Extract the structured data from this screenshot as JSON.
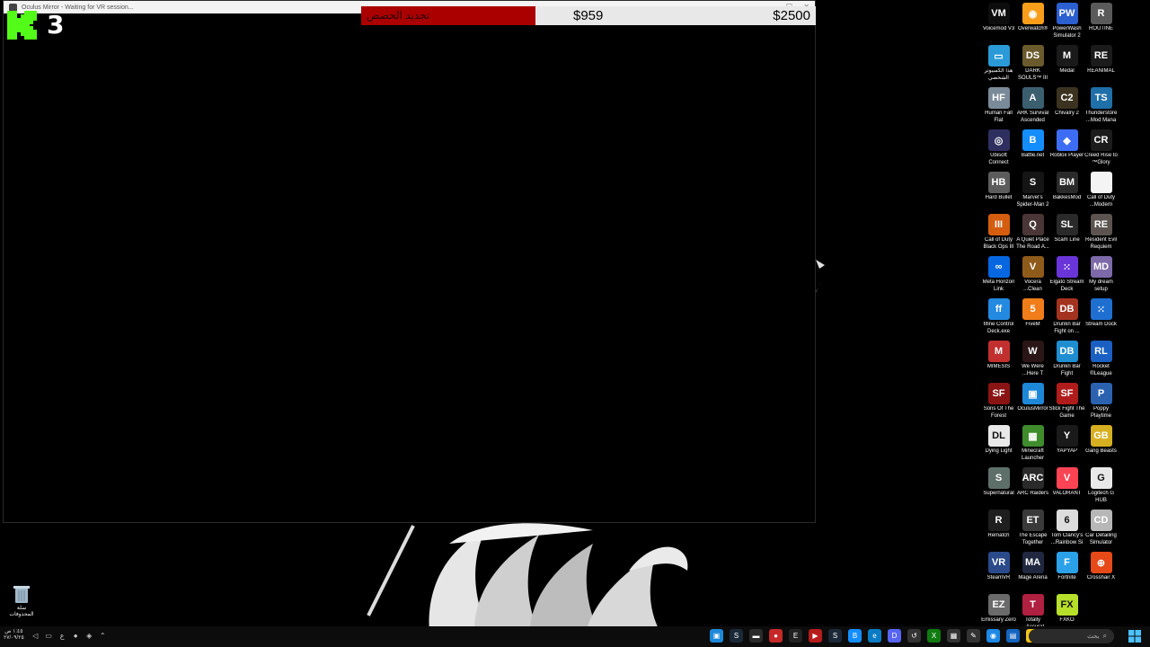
{
  "window": {
    "title": "Oculus Mirror - Waiting for VR session...",
    "controls": [
      "—",
      "☐",
      "✕"
    ]
  },
  "overlay": {
    "kick_count": "3",
    "goal": {
      "label": "تجديد الحصص",
      "current": "$959",
      "target": "$2500",
      "progress": 0.3836,
      "fill_color": "#aa0000"
    }
  },
  "desktop_icons": [
    {
      "label": "Voicemod V3",
      "icon": "voicemod-icon",
      "color": "#0d0d0d",
      "glyph": "VM"
    },
    {
      "label": "Overwatch®",
      "icon": "overwatch-icon",
      "color": "#f99e1a",
      "glyph": "◉"
    },
    {
      "label": "PowerWash Simulator 2",
      "icon": "powerwash-icon",
      "color": "#2c5fcf",
      "glyph": "PW"
    },
    {
      "label": "ROUTINE",
      "icon": "routine-icon",
      "color": "#5a5a5a",
      "glyph": "R"
    },
    {
      "label": "هذا الكمبيوتر الشخصي",
      "icon": "this-pc-icon",
      "color": "#2b9ad8",
      "glyph": "▭"
    },
    {
      "label": "DARK SOULS™ III",
      "icon": "dark-souls-icon",
      "color": "#6b5a2c",
      "glyph": "DS"
    },
    {
      "label": "Medal",
      "icon": "medal-icon",
      "color": "#1a1a1a",
      "glyph": "M"
    },
    {
      "label": "REANIMAL",
      "icon": "reanimal-icon",
      "color": "#1b1b1b",
      "glyph": "RE"
    },
    {
      "label": "Human Fall Flat",
      "icon": "human-fall-flat-icon",
      "color": "#7b8a99",
      "glyph": "HF"
    },
    {
      "label": "ARK Survival Ascended",
      "icon": "ark-icon",
      "color": "#3c5f6f",
      "glyph": "A"
    },
    {
      "label": "Chivalry 2",
      "icon": "chivalry-icon",
      "color": "#3b3320",
      "glyph": "C2"
    },
    {
      "label": "Thunderstore ...Mod Mana",
      "icon": "thunderstore-icon",
      "color": "#1f6fa8",
      "glyph": "TS"
    },
    {
      "label": "Ubisoft Connect",
      "icon": "ubisoft-icon",
      "color": "#2f2f5f",
      "glyph": "◎"
    },
    {
      "label": "Battle.net",
      "icon": "battlenet-icon",
      "color": "#148eff",
      "glyph": "B"
    },
    {
      "label": "Roblox Player",
      "icon": "roblox-icon",
      "color": "#3e6df5",
      "glyph": "◆"
    },
    {
      "label": "Creed Rise to ™Glory",
      "icon": "creed-icon",
      "color": "#1c1c1c",
      "glyph": "CR"
    },
    {
      "label": "Hard Bullet",
      "icon": "hard-bullet-icon",
      "color": "#5c5c5c",
      "glyph": "HB"
    },
    {
      "label": "Marvel's Spider-Man 2",
      "icon": "spiderman-icon",
      "color": "#151515",
      "glyph": "S"
    },
    {
      "label": "BakkesMod",
      "icon": "bakkesmod-icon",
      "color": "#2a2a2a",
      "glyph": "BM"
    },
    {
      "label": "Call of Duty ...Modern",
      "icon": "file-icon",
      "color": "#f4f4f4",
      "glyph": ""
    },
    {
      "label": "Call of Duty Black Ops III",
      "icon": "black-ops-icon",
      "color": "#d45d10",
      "glyph": "III"
    },
    {
      "label": "A Quiet Place The Road A...",
      "icon": "quiet-place-icon",
      "color": "#4a3636",
      "glyph": "Q"
    },
    {
      "label": "Scam Line",
      "icon": "scam-line-icon",
      "color": "#2a2a2a",
      "glyph": "SL"
    },
    {
      "label": "Resident Evil Requiem",
      "icon": "resident-evil-icon",
      "color": "#5b5450",
      "glyph": "RE"
    },
    {
      "label": "Meta Horizon Link",
      "icon": "meta-icon",
      "color": "#0667e0",
      "glyph": "∞"
    },
    {
      "label": "Vocera ...Clean",
      "icon": "vocera-icon",
      "color": "#8f5b1a",
      "glyph": "V"
    },
    {
      "label": "Elgato Stream Deck",
      "icon": "stream-deck-icon",
      "color": "#6a35d8",
      "glyph": "⁙"
    },
    {
      "label": "My dream setup",
      "icon": "dream-setup-icon",
      "color": "#7d6aa8",
      "glyph": "MD"
    },
    {
      "label": "fifine Control Deck.exe",
      "icon": "fifine-icon",
      "color": "#2489e0",
      "glyph": "ff"
    },
    {
      "label": "FiveM",
      "icon": "fivem-icon",
      "color": "#f07d1a",
      "glyph": "5"
    },
    {
      "label": "Drunkn Bar Fight on ...",
      "icon": "drunkn-bar-icon",
      "color": "#a3331f",
      "glyph": "DB"
    },
    {
      "label": "Stream Dock",
      "icon": "stream-dock-icon",
      "color": "#1f6fd0",
      "glyph": "⁙"
    },
    {
      "label": "MIMESIS",
      "icon": "mimesis-icon",
      "color": "#c22f2f",
      "glyph": "M"
    },
    {
      "label": "We Were ...Here T",
      "icon": "we-were-here-icon",
      "color": "#2a1616",
      "glyph": "W"
    },
    {
      "label": "Drunkn Bar Fight",
      "icon": "drunkn-bar-fight-icon",
      "color": "#1f8ed0",
      "glyph": "DB"
    },
    {
      "label": "Rocket ®League",
      "icon": "rocket-league-icon",
      "color": "#1a5fc2",
      "glyph": "RL"
    },
    {
      "label": "Sons Of The Forest",
      "icon": "sons-forest-icon",
      "color": "#8a1414",
      "glyph": "SF"
    },
    {
      "label": "OculusMirror",
      "icon": "oculus-mirror-icon",
      "color": "#1e88d8",
      "glyph": "▣"
    },
    {
      "label": "Stick Fight The Game",
      "icon": "stick-fight-icon",
      "color": "#b01c1c",
      "glyph": "SF"
    },
    {
      "label": "Poppy Playtime",
      "icon": "poppy-icon",
      "color": "#2b62b0",
      "glyph": "P"
    },
    {
      "label": "Dying Light",
      "icon": "dying-light-icon",
      "color": "#e9e9e9",
      "glyph": "DL"
    },
    {
      "label": "Minecraft Launcher",
      "icon": "minecraft-icon",
      "color": "#3f8c2d",
      "glyph": "▦"
    },
    {
      "label": "YAPYAP",
      "icon": "yapyap-icon",
      "color": "#1a1a1a",
      "glyph": "Y"
    },
    {
      "label": "Gang Beasts",
      "icon": "gang-beasts-icon",
      "color": "#d6b021",
      "glyph": "GB"
    },
    {
      "label": "Supernatural",
      "icon": "supernatural-icon",
      "color": "#5e6f6a",
      "glyph": "S"
    },
    {
      "label": "ARC Raiders",
      "icon": "arc-raiders-icon",
      "color": "#2a2a2a",
      "glyph": "ARC"
    },
    {
      "label": "VALORANT",
      "icon": "valorant-icon",
      "color": "#fa4454",
      "glyph": "V"
    },
    {
      "label": "Logitech G HUB",
      "icon": "logitech-icon",
      "color": "#e8e8e8",
      "glyph": "G"
    },
    {
      "label": "Rematch",
      "icon": "rematch-icon",
      "color": "#1f1f1f",
      "glyph": "R"
    },
    {
      "label": "The Escape Together",
      "icon": "escape-together-icon",
      "color": "#3a3a3a",
      "glyph": "ET"
    },
    {
      "label": "Tom Clancy's ...Rainbow Si",
      "icon": "rainbow-six-icon",
      "color": "#dcdcdc",
      "glyph": "6"
    },
    {
      "label": "Car Detailing Simulator",
      "icon": "car-detailing-icon",
      "color": "#b7b7b7",
      "glyph": "CD"
    },
    {
      "label": "SteamVR",
      "icon": "steamvr-icon",
      "color": "#2a4a8a",
      "glyph": "VR"
    },
    {
      "label": "Mage Arena",
      "icon": "mage-arena-icon",
      "color": "#202840",
      "glyph": "MA"
    },
    {
      "label": "Fortnite",
      "icon": "fortnite-icon",
      "color": "#2aa1e8",
      "glyph": "F"
    },
    {
      "label": "Crosshair X",
      "icon": "crosshair-icon",
      "color": "#e64a19",
      "glyph": "⊕"
    },
    {
      "label": "Emissary Zero",
      "icon": "emissary-icon",
      "color": "#6a6a6a",
      "glyph": "EZ"
    },
    {
      "label": "Totally ...Accurat",
      "icon": "tabs-icon",
      "color": "#b02040",
      "glyph": "T"
    },
    {
      "label": "FXKO",
      "icon": "fxko-icon",
      "color": "#b7e02a",
      "glyph": "FX"
    }
  ],
  "recycle_bin": {
    "label": "سلة المحذوفات"
  },
  "taskbar": {
    "clock_time": "١:٤٥ ص",
    "clock_date": "٢٧/٠٩/٢٥",
    "lang": "ع",
    "search_placeholder": "بحث",
    "apps": [
      {
        "icon": "oculus-taskbar-icon",
        "color": "#1e88d8",
        "glyph": "▣"
      },
      {
        "icon": "steam-taskbar-icon",
        "color": "#1b2838",
        "glyph": "S"
      },
      {
        "icon": "controller-taskbar-icon",
        "color": "#2a2a2a",
        "glyph": "▬"
      },
      {
        "icon": "recorder-taskbar-icon",
        "color": "#c62828",
        "glyph": "●"
      },
      {
        "icon": "epic-taskbar-icon",
        "color": "#222",
        "glyph": "E"
      },
      {
        "icon": "media-taskbar-icon",
        "color": "#b71c1c",
        "glyph": "▶"
      },
      {
        "icon": "steam2-taskbar-icon",
        "color": "#1b2838",
        "glyph": "S"
      },
      {
        "icon": "battlenet-taskbar-icon",
        "color": "#148eff",
        "glyph": "B"
      },
      {
        "icon": "edge-taskbar-icon",
        "color": "#0a7cc5",
        "glyph": "e"
      },
      {
        "icon": "discord-taskbar-icon",
        "color": "#5865f2",
        "glyph": "D"
      },
      {
        "icon": "arrow-taskbar-icon",
        "color": "#333",
        "glyph": "↺"
      },
      {
        "icon": "xbox-taskbar-icon",
        "color": "#107c10",
        "glyph": "X"
      },
      {
        "icon": "calculator-taskbar-icon",
        "color": "#333",
        "glyph": "▦"
      },
      {
        "icon": "paint-taskbar-icon",
        "color": "#333",
        "glyph": "✎"
      },
      {
        "icon": "chrome-taskbar-icon",
        "color": "#1e88e5",
        "glyph": "◉"
      },
      {
        "icon": "store-taskbar-icon",
        "color": "#1565c0",
        "glyph": "▤"
      },
      {
        "icon": "explorer-taskbar-icon",
        "color": "#f5c518",
        "glyph": "▭"
      },
      {
        "icon": "window-taskbar-icon",
        "color": "#444",
        "glyph": "▢"
      }
    ]
  }
}
